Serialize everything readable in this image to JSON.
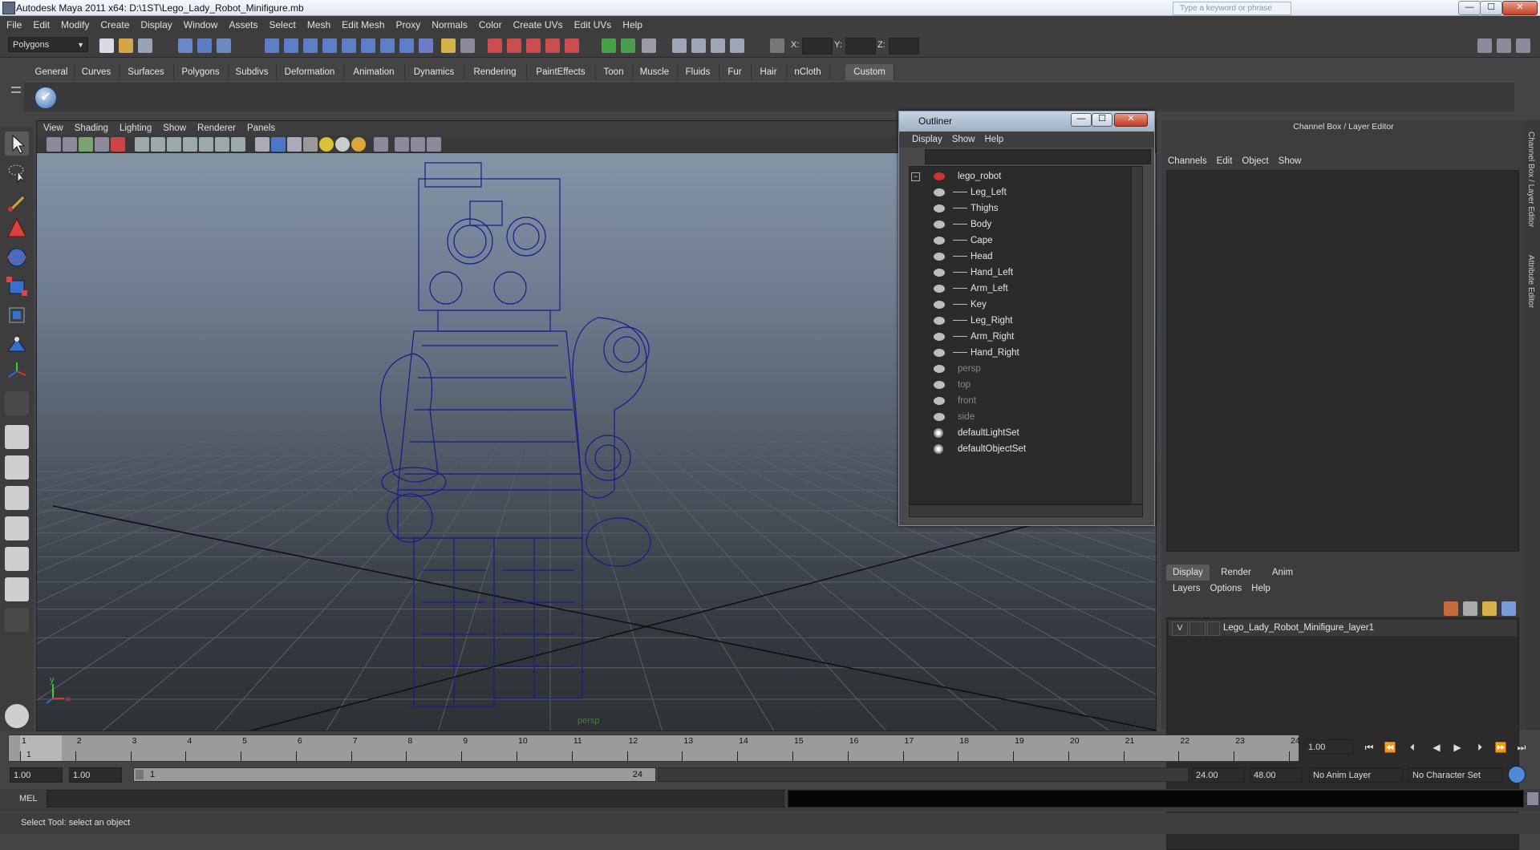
{
  "window": {
    "title": "Autodesk Maya 2011 x64: D:\\1ST\\Lego_Lady_Robot_Minifigure.mb",
    "search_placeholder": "Type a keyword or phrase",
    "min": "—",
    "max": "☐",
    "close": "✕"
  },
  "menubar": [
    "File",
    "Edit",
    "Modify",
    "Create",
    "Display",
    "Window",
    "Assets",
    "Select",
    "Mesh",
    "Edit Mesh",
    "Proxy",
    "Normals",
    "Color",
    "Create UVs",
    "Edit UVs",
    "Help"
  ],
  "statusline": {
    "mode": "Polygons",
    "x_label": "X:",
    "y_label": "Y:",
    "z_label": "Z:"
  },
  "shelf": {
    "tabs": [
      "General",
      "Curves",
      "Surfaces",
      "Polygons",
      "Subdivs",
      "Deformation",
      "Animation",
      "Dynamics",
      "Rendering",
      "PaintEffects",
      "Toon",
      "Muscle",
      "Fluids",
      "Fur",
      "Hair",
      "nCloth",
      "Custom"
    ],
    "active_tab": "Custom",
    "check_glyph": "✔"
  },
  "viewport": {
    "menu": [
      "View",
      "Shading",
      "Lighting",
      "Show",
      "Renderer",
      "Panels"
    ],
    "camera_label": "persp",
    "axis_y": "y",
    "axis_x": "x"
  },
  "outliner": {
    "title": "Outliner",
    "menu": [
      "Display",
      "Show",
      "Help"
    ],
    "items": [
      {
        "label": "lego_robot",
        "type": "transform-root",
        "dim": false
      },
      {
        "label": "Leg_Left",
        "type": "mesh",
        "dim": false
      },
      {
        "label": "Thighs",
        "type": "mesh",
        "dim": false
      },
      {
        "label": "Body",
        "type": "mesh",
        "dim": false
      },
      {
        "label": "Cape",
        "type": "mesh",
        "dim": false
      },
      {
        "label": "Head",
        "type": "mesh",
        "dim": false
      },
      {
        "label": "Hand_Left",
        "type": "mesh",
        "dim": false
      },
      {
        "label": "Arm_Left",
        "type": "mesh",
        "dim": false
      },
      {
        "label": "Key",
        "type": "mesh",
        "dim": false
      },
      {
        "label": "Leg_Right",
        "type": "mesh",
        "dim": false
      },
      {
        "label": "Arm_Right",
        "type": "mesh",
        "dim": false
      },
      {
        "label": "Hand_Right",
        "type": "mesh",
        "dim": false
      },
      {
        "label": "persp",
        "type": "camera",
        "dim": true
      },
      {
        "label": "top",
        "type": "camera",
        "dim": true
      },
      {
        "label": "front",
        "type": "camera",
        "dim": true
      },
      {
        "label": "side",
        "type": "camera",
        "dim": true
      },
      {
        "label": "defaultLightSet",
        "type": "set",
        "dim": false
      },
      {
        "label": "defaultObjectSet",
        "type": "set",
        "dim": false
      }
    ]
  },
  "channelbox": {
    "title": "Channel Box / Layer Editor",
    "menu": [
      "Channels",
      "Edit",
      "Object",
      "Show"
    ],
    "layer_tabs": [
      "Display",
      "Render",
      "Anim"
    ],
    "active_layer_tab": "Display",
    "layer_menu": [
      "Layers",
      "Options",
      "Help"
    ],
    "layer": {
      "visible": "V",
      "name": "Lego_Lady_Robot_Minifigure_layer1"
    },
    "side_tabs": [
      "Channel Box / Layer Editor",
      "Attribute Editor"
    ]
  },
  "timeline": {
    "numbers": [
      "1",
      "2",
      "3",
      "4",
      "5",
      "6",
      "7",
      "8",
      "9",
      "10",
      "11",
      "12",
      "13",
      "14",
      "15",
      "16",
      "17",
      "18",
      "19",
      "20",
      "21",
      "22",
      "23",
      "24"
    ],
    "current_frame": "1",
    "current_field": "1.00"
  },
  "range": {
    "start": "1.00",
    "start2": "1.00",
    "bar_start": "1",
    "bar_end": "24",
    "end": "24.00",
    "end2": "48.00",
    "anim_layer": "No Anim Layer",
    "character_set": "No Character Set"
  },
  "cmdline": {
    "label": "MEL"
  },
  "helpline": {
    "text": "Select Tool: select an object"
  },
  "colors": {
    "viewport_top": "#8a98ad",
    "wire": "#1a1a8c",
    "ui_bg": "#444444"
  }
}
